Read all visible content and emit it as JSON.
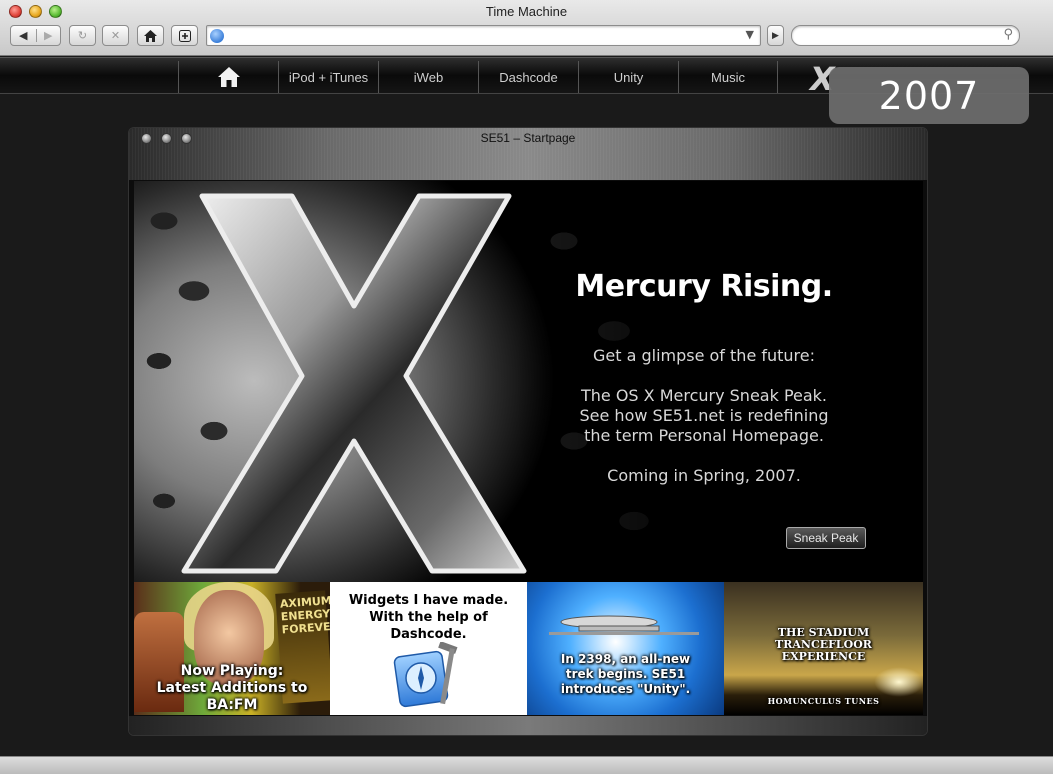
{
  "browser": {
    "window_title": "Time Machine",
    "url_value": "",
    "search_value": ""
  },
  "navbar": {
    "items": [
      "iPod + iTunes",
      "iWeb",
      "Dashcode",
      "Unity",
      "Music"
    ],
    "logo_text": "X"
  },
  "badge": {
    "year": "2007"
  },
  "inner_window": {
    "title": "SE51 – Startpage"
  },
  "hero": {
    "heading": "Mercury Rising.",
    "line1": "Get a glimpse of the future:",
    "line2": "The OS X Mercury Sneak Peak.",
    "line3": "See how SE51.net is redefining",
    "line4": "the term Personal Homepage.",
    "line5": "Coming in Spring, 2007.",
    "button_label": "Sneak Peak"
  },
  "tiles": [
    {
      "line1": "Now Playing:",
      "line2": "Latest Additions to BA:FM",
      "cover_text": "AXIMUM ENERGY FOREVER"
    },
    {
      "line1": "Widgets I have made.",
      "line2": "With the help of Dashcode."
    },
    {
      "line1": "In 2398, an all-new",
      "line2": "trek begins. SE51",
      "line3": "introduces \"Unity\"."
    },
    {
      "line1": "THE STADIUM",
      "line2": "TRANCEFLOOR",
      "line3": "EXPERIENCE",
      "line4": "HOMUNCULUS TUNES"
    }
  ],
  "colors": {
    "accent": "#ffffff",
    "badge_bg": "#6e6e6e",
    "nav_bg": "#0a0a0a"
  }
}
